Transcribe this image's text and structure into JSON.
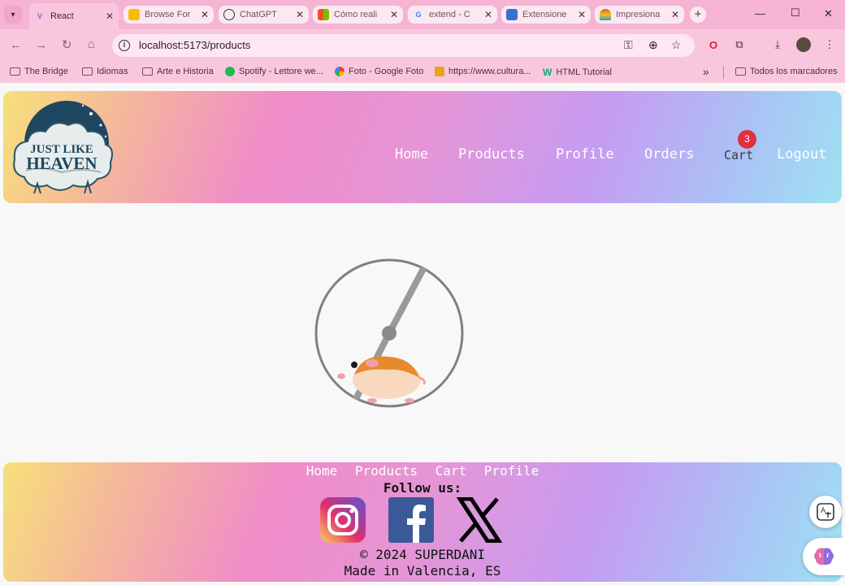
{
  "browser": {
    "tabs": [
      {
        "title": "React",
        "active": true
      },
      {
        "title": "Browse For"
      },
      {
        "title": "ChatGPT"
      },
      {
        "title": "Cómo reali"
      },
      {
        "title": "extend - C"
      },
      {
        "title": "Extensione"
      },
      {
        "title": "Impresiona"
      }
    ],
    "url": "localhost:5173/products",
    "bookmarks": [
      "The Bridge",
      "Idiomas",
      "Arte e Historia",
      "Spotify - Lettore we...",
      "Foto - Google Foto",
      "https://www.cultura...",
      "HTML Tutorial"
    ],
    "all_bookmarks": "Todos los marcadores"
  },
  "logo": {
    "line1": "JUST LIKE",
    "line2": "HEAVEN"
  },
  "nav": {
    "home": "Home",
    "products": "Products",
    "profile": "Profile",
    "orders": "Orders",
    "cart": "Cart",
    "cart_count": "3",
    "logout": "Logout"
  },
  "footer": {
    "links": [
      "Home",
      "Products",
      "Cart",
      "Profile"
    ],
    "follow": "Follow us:",
    "copyright": "© 2024 SUPERDANI",
    "made_in": "Made in Valencia, ES"
  },
  "colors": {
    "chrome_pink": "#f9c7dd",
    "badge_red": "#e03040"
  }
}
